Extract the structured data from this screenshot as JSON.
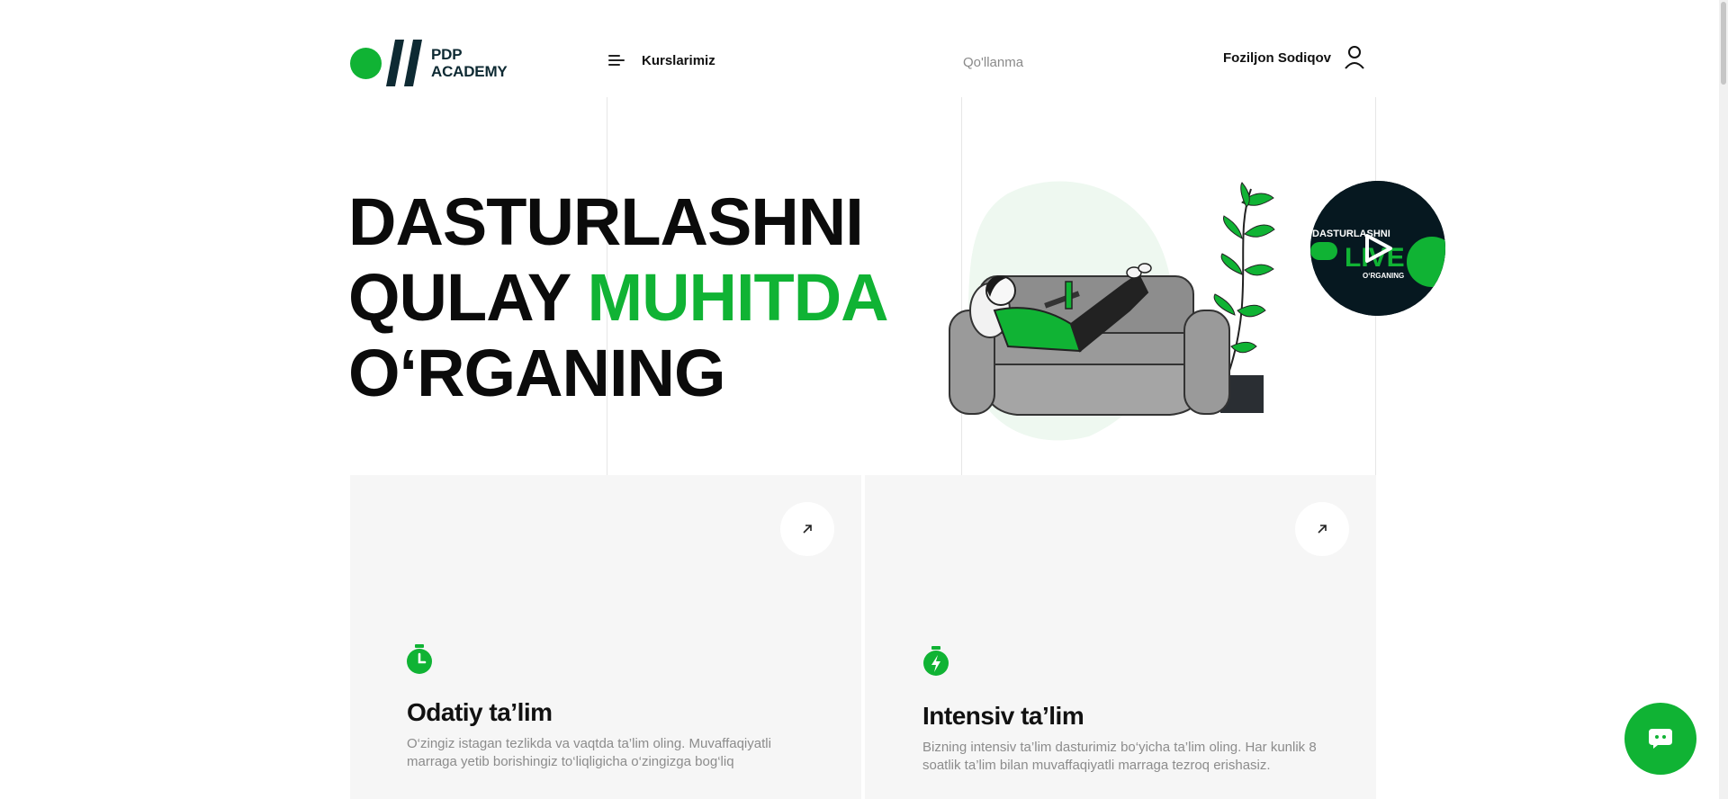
{
  "header": {
    "logo_line1": "PDP",
    "logo_line2": "ACADEMY",
    "courses_label": "Kurslarimiz",
    "guide_label": "Qo'llanma",
    "user_name": "Foziljon Sodiqov"
  },
  "hero": {
    "line1": "DASTURLASHNI",
    "line2_part1": "QULAY",
    "line2_accent": "MUHITDA",
    "line3": "O‘RGANING"
  },
  "video": {
    "thumb_line1": "DASTURLASHNI",
    "thumb_line2": "LIVE",
    "thumb_line3": "O‘RGANING"
  },
  "cards": [
    {
      "title": "Odatiy ta’lim",
      "description": "O‘zingiz istagan tezlikda va vaqtda ta’lim oling. Muvaffaqiyatli marraga yetib borishingiz to‘liqligicha o‘zingizga bog‘liq",
      "icon": "stopwatch-icon"
    },
    {
      "title": "Intensiv ta’lim",
      "description": "Bizning intensiv ta’lim dasturimiz bo‘yicha ta’lim oling. Har kunlik 8 soatlik ta’lim bilan muvaffaqiyatli marraga tezroq erishasiz.",
      "icon": "lightning-stopwatch-icon"
    }
  ],
  "colors": {
    "accent": "#10b334",
    "dark": "#0e2a33",
    "card_bg": "#f6f6f6",
    "muted_text": "#8c8c8c"
  }
}
